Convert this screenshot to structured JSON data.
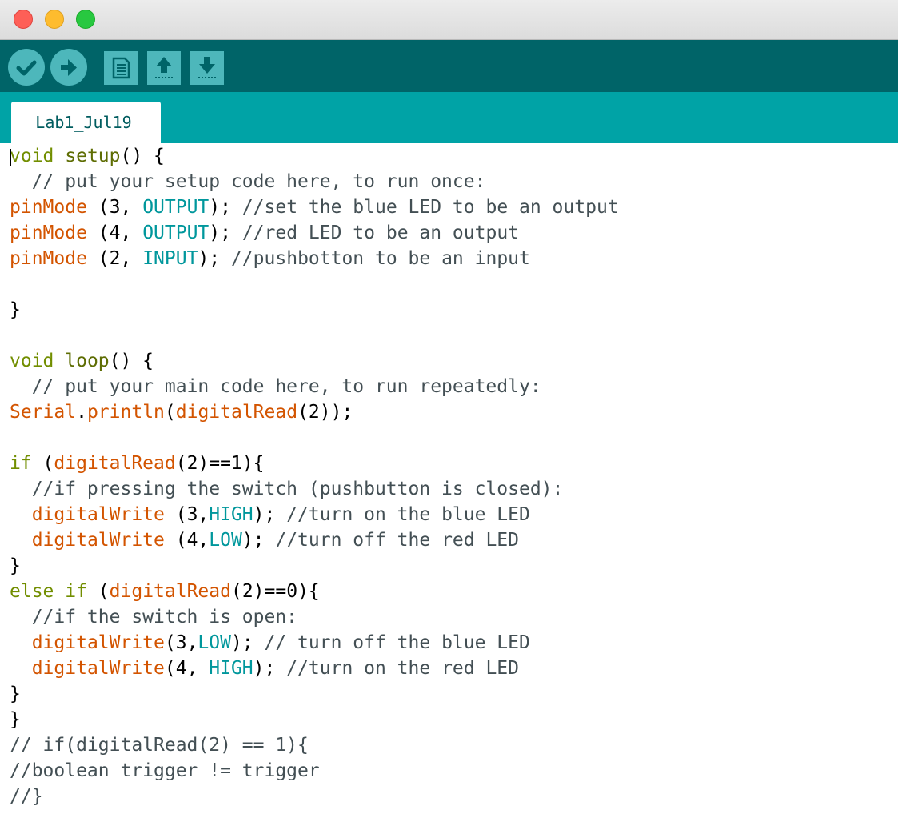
{
  "window": {
    "buttons": [
      "close",
      "minimize",
      "zoom"
    ]
  },
  "toolbar": {
    "buttons": [
      {
        "name": "verify",
        "icon": "checkmark-icon"
      },
      {
        "name": "upload",
        "icon": "arrow-right-icon"
      },
      {
        "name": "new",
        "icon": "new-file-icon"
      },
      {
        "name": "open",
        "icon": "open-upload-icon"
      },
      {
        "name": "save",
        "icon": "save-download-icon"
      }
    ]
  },
  "tabs": [
    {
      "label": "Lab1_Jul19",
      "active": true
    }
  ],
  "colors": {
    "toolbar_bg": "#006468",
    "tabbar_bg": "#00a3a6",
    "button_bg": "#4db7bb",
    "keyword": "#728e00",
    "function": "#d35400",
    "constant": "#00979c",
    "comment": "#434f54"
  },
  "code": [
    [
      [
        "kw",
        "void"
      ],
      [
        "plain",
        " "
      ],
      [
        "kw2",
        "setup"
      ],
      [
        "plain",
        "() {"
      ]
    ],
    [
      [
        "cmt",
        "  // put your setup code here, to run once:"
      ]
    ],
    [
      [
        "fn",
        "pinMode"
      ],
      [
        "plain",
        " (3, "
      ],
      [
        "const",
        "OUTPUT"
      ],
      [
        "plain",
        "); "
      ],
      [
        "cmt",
        "//set the blue LED to be an output"
      ]
    ],
    [
      [
        "fn",
        "pinMode"
      ],
      [
        "plain",
        " (4, "
      ],
      [
        "const",
        "OUTPUT"
      ],
      [
        "plain",
        "); "
      ],
      [
        "cmt",
        "//red LED to be an output"
      ]
    ],
    [
      [
        "fn",
        "pinMode"
      ],
      [
        "plain",
        " (2, "
      ],
      [
        "const",
        "INPUT"
      ],
      [
        "plain",
        "); "
      ],
      [
        "cmt",
        "//pushbotton to be an input"
      ]
    ],
    [
      [
        "plain",
        ""
      ]
    ],
    [
      [
        "plain",
        "}"
      ]
    ],
    [
      [
        "plain",
        ""
      ]
    ],
    [
      [
        "kw",
        "void"
      ],
      [
        "plain",
        " "
      ],
      [
        "kw2",
        "loop"
      ],
      [
        "plain",
        "() {"
      ]
    ],
    [
      [
        "cmt",
        "  // put your main code here, to run repeatedly:"
      ]
    ],
    [
      [
        "fn",
        "Serial"
      ],
      [
        "plain",
        "."
      ],
      [
        "fn",
        "println"
      ],
      [
        "plain",
        "("
      ],
      [
        "fn",
        "digitalRead"
      ],
      [
        "plain",
        "(2));"
      ]
    ],
    [
      [
        "plain",
        ""
      ]
    ],
    [
      [
        "kw",
        "if"
      ],
      [
        "plain",
        " ("
      ],
      [
        "fn",
        "digitalRead"
      ],
      [
        "plain",
        "(2)==1){"
      ]
    ],
    [
      [
        "cmt",
        "  //if pressing the switch (pushbutton is closed):"
      ]
    ],
    [
      [
        "plain",
        "  "
      ],
      [
        "fn",
        "digitalWrite"
      ],
      [
        "plain",
        " (3,"
      ],
      [
        "const",
        "HIGH"
      ],
      [
        "plain",
        "); "
      ],
      [
        "cmt",
        "//turn on the blue LED"
      ]
    ],
    [
      [
        "plain",
        "  "
      ],
      [
        "fn",
        "digitalWrite"
      ],
      [
        "plain",
        " (4,"
      ],
      [
        "const",
        "LOW"
      ],
      [
        "plain",
        "); "
      ],
      [
        "cmt",
        "//turn off the red LED"
      ]
    ],
    [
      [
        "plain",
        "}"
      ]
    ],
    [
      [
        "kw",
        "else"
      ],
      [
        "plain",
        " "
      ],
      [
        "kw",
        "if"
      ],
      [
        "plain",
        " ("
      ],
      [
        "fn",
        "digitalRead"
      ],
      [
        "plain",
        "(2)==0){"
      ]
    ],
    [
      [
        "cmt",
        "  //if the switch is open:"
      ]
    ],
    [
      [
        "plain",
        "  "
      ],
      [
        "fn",
        "digitalWrite"
      ],
      [
        "plain",
        "(3,"
      ],
      [
        "const",
        "LOW"
      ],
      [
        "plain",
        "); "
      ],
      [
        "cmt",
        "// turn off the blue LED"
      ]
    ],
    [
      [
        "plain",
        "  "
      ],
      [
        "fn",
        "digitalWrite"
      ],
      [
        "plain",
        "(4, "
      ],
      [
        "const",
        "HIGH"
      ],
      [
        "plain",
        "); "
      ],
      [
        "cmt",
        "//turn on the red LED"
      ]
    ],
    [
      [
        "plain",
        "}"
      ]
    ],
    [
      [
        "plain",
        "}"
      ]
    ],
    [
      [
        "cmt",
        "// if(digitalRead(2) == 1){"
      ]
    ],
    [
      [
        "cmt",
        "//boolean trigger != trigger"
      ]
    ],
    [
      [
        "cmt",
        "//}"
      ]
    ]
  ]
}
